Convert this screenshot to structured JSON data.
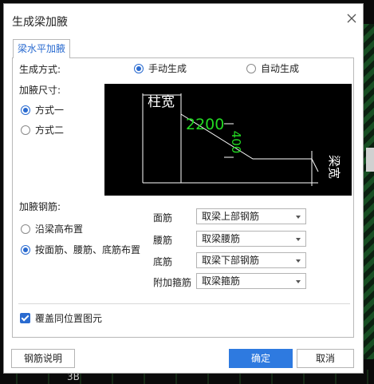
{
  "background": {
    "text": "3B"
  },
  "dialog": {
    "title": "生成梁加腋",
    "tab": "梁水平加腋",
    "generation": {
      "label": "生成方式:",
      "options": [
        {
          "label": "手动生成",
          "selected": true
        },
        {
          "label": "自动生成",
          "selected": false
        }
      ]
    },
    "size": {
      "label": "加腋尺寸:",
      "options": [
        {
          "label": "方式一",
          "selected": true
        },
        {
          "label": "方式二",
          "selected": false
        }
      ]
    },
    "diagram": {
      "column_width_label": "柱宽",
      "length_value": "2200",
      "width_value": "400",
      "beam_width_label": "梁宽",
      "colors": {
        "line": "#ffffff",
        "dimension": "#22d822"
      }
    },
    "rebar": {
      "label": "加腋钢筋:",
      "options": [
        {
          "label": "沿梁高布置",
          "selected": false
        },
        {
          "label": "按面筋、腰筋、底筋布置",
          "selected": true
        }
      ],
      "rows": [
        {
          "label": "面筋",
          "value": "取梁上部钢筋"
        },
        {
          "label": "腰筋",
          "value": "取梁腰筋"
        },
        {
          "label": "底筋",
          "value": "取梁下部钢筋"
        },
        {
          "label": "附加箍筋",
          "value": "取梁箍筋"
        }
      ]
    },
    "overwrite": {
      "label": "覆盖同位置图元",
      "checked": true
    },
    "buttons": {
      "help": "钢筋说明",
      "ok": "确定",
      "cancel": "取消"
    },
    "colors": {
      "accent": "#2a6bd0",
      "primary_button": "#2e7ae0"
    }
  }
}
